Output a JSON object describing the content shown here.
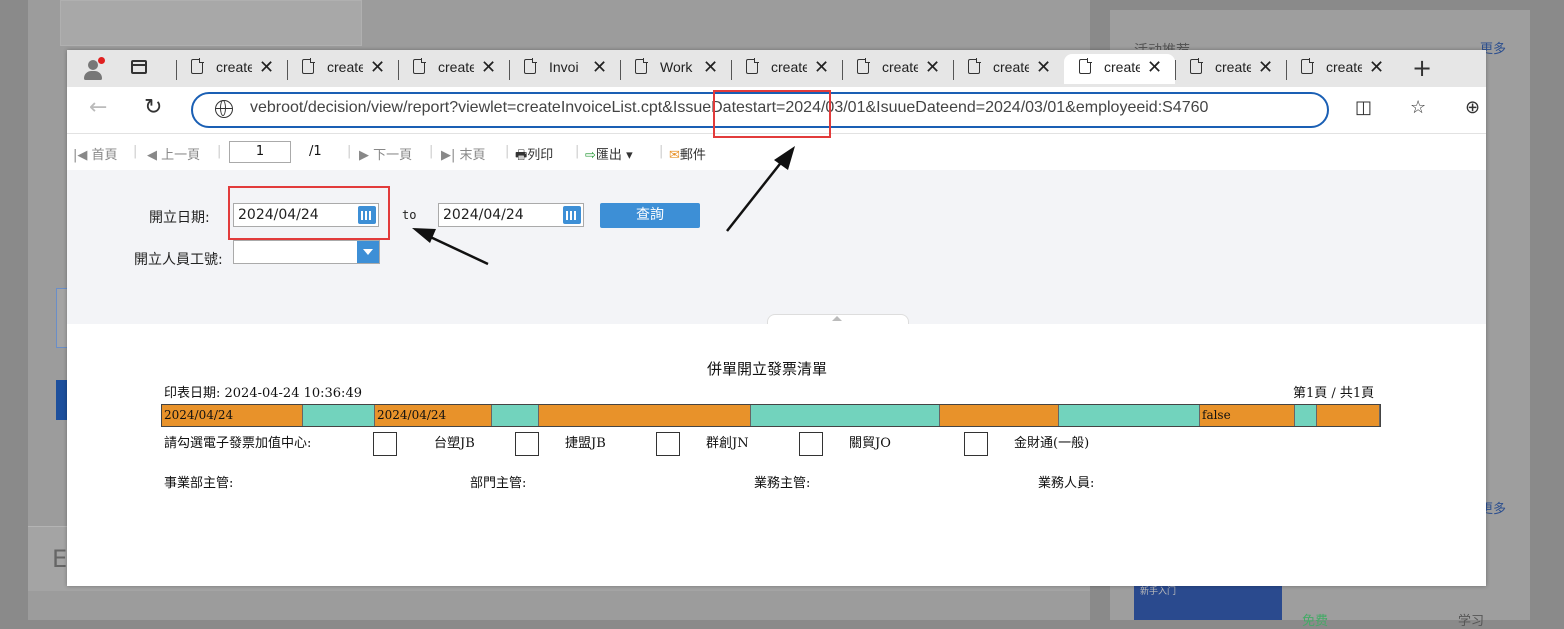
{
  "browser": {
    "tabs": [
      {
        "title": "create"
      },
      {
        "title": "create"
      },
      {
        "title": "create"
      },
      {
        "title": "Invoi"
      },
      {
        "title": "Work"
      },
      {
        "title": "create"
      },
      {
        "title": "create"
      },
      {
        "title": "create"
      },
      {
        "title": "create",
        "active": true
      },
      {
        "title": "create"
      },
      {
        "title": "create"
      }
    ],
    "url": "vebroot/decision/view/report?viewlet=createInvoiceList.cpt&IssueDatestart=2024/03/01&IsuueDateend=2024/03/01&employeeid:S4760"
  },
  "toolbar": {
    "first": "首頁",
    "prev": "上一頁",
    "page_value": "1",
    "page_total": "/1",
    "next": "下一頁",
    "last": "末頁",
    "print": "列印",
    "export": "匯出",
    "mail": "郵件"
  },
  "query": {
    "date_label": "開立日期:",
    "date_start": "2024/04/24",
    "to_label": "to",
    "date_end": "2024/04/24",
    "query_button": "查詢",
    "employee_label": "開立人員工號:",
    "employee_value": ""
  },
  "report": {
    "title": "併單開立發票清單",
    "print_date": "印表日期: 2024-04-24 10:36:49",
    "page_info": "第1頁 / 共1頁",
    "strip_cells": [
      {
        "text": "2024/04/24",
        "color": "#e8922a"
      },
      {
        "text": "",
        "color": "#72d3bd"
      },
      {
        "text": "2024/04/24",
        "color": "#e8922a"
      },
      {
        "text": "",
        "color": "#72d3bd"
      },
      {
        "text": "",
        "color": "#e8922a"
      },
      {
        "text": "",
        "color": "#72d3bd"
      },
      {
        "text": "",
        "color": "#e8922a"
      },
      {
        "text": "",
        "color": "#72d3bd"
      },
      {
        "text": "false",
        "color": "#e8922a"
      },
      {
        "text": "",
        "color": "#72d3bd"
      },
      {
        "text": "",
        "color": "#e8922a"
      }
    ],
    "checkbox_prompt": "請勾選電子發票加值中心:",
    "options": [
      "台塑JB",
      "捷盟JB",
      "群創JN",
      "關貿JO",
      "金財通(一般)"
    ],
    "sign_labels": [
      "事業部主管:",
      "部門主管:",
      "業務主管:",
      "業務人員:"
    ]
  },
  "background": {
    "card_heading": "活动推荐",
    "more_label": "更多",
    "side_letter": "E",
    "ad_text": "新手入门",
    "free_label": "免费",
    "learn_label": "学习"
  },
  "colors": {
    "accent_blue": "#3d8fd6",
    "annotation_red": "#e23b3b",
    "strip_orange": "#e8922a",
    "strip_teal": "#72d3bd"
  }
}
